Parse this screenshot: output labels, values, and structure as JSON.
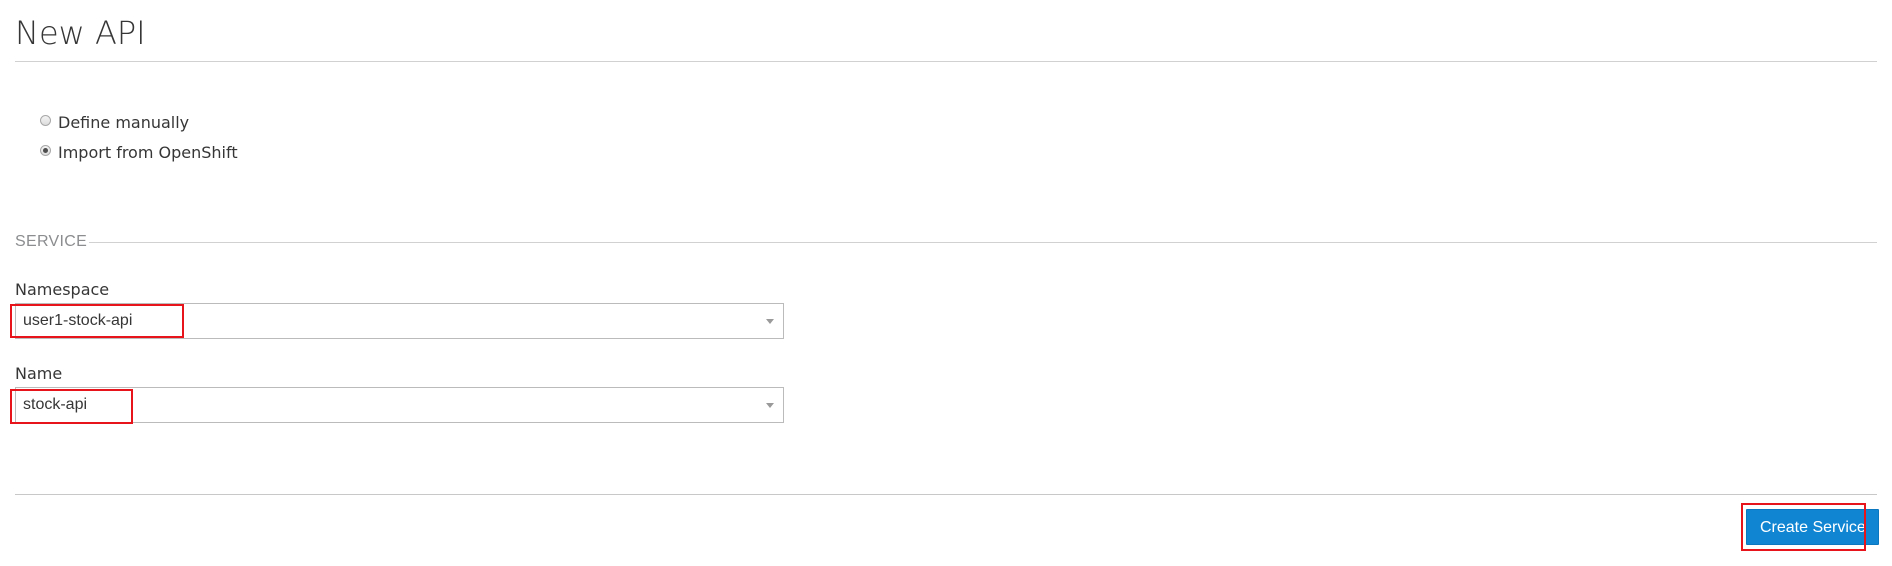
{
  "page": {
    "title": "New API"
  },
  "import_options": {
    "items": [
      {
        "label": "Define manually",
        "checked": false
      },
      {
        "label": "Import from OpenShift",
        "checked": true
      }
    ]
  },
  "service_section": {
    "legend": "SERVICE",
    "namespace": {
      "label": "Namespace",
      "value": "user1-stock-api"
    },
    "name": {
      "label": "Name",
      "value": "stock-api"
    }
  },
  "footer": {
    "create_label": "Create Service"
  },
  "colors": {
    "primary_button": "#1086d3",
    "highlight_box": "#e8141b"
  }
}
